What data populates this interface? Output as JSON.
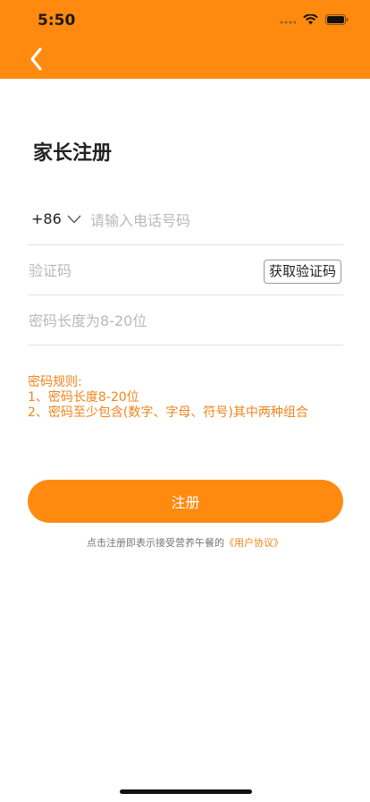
{
  "status_bar": {
    "time": "5:50"
  },
  "page": {
    "title": "家长注册"
  },
  "form": {
    "country_code": "+86",
    "phone_placeholder": "请输入电话号码",
    "code_placeholder": "验证码",
    "get_code_label": "获取验证码",
    "password_placeholder": "密码长度为8-20位"
  },
  "rules": {
    "heading": "密码规则:",
    "items": [
      "1、密码长度8-20位",
      "2、密码至少包含(数字、字母、符号)其中两种组合"
    ]
  },
  "submit": {
    "label": "注册"
  },
  "agreement": {
    "prefix": "点击注册即表示接受营养午餐的",
    "link": "《用户协议》"
  },
  "colors": {
    "accent": "#FF8A0F",
    "rule_text": "#F0841C"
  }
}
